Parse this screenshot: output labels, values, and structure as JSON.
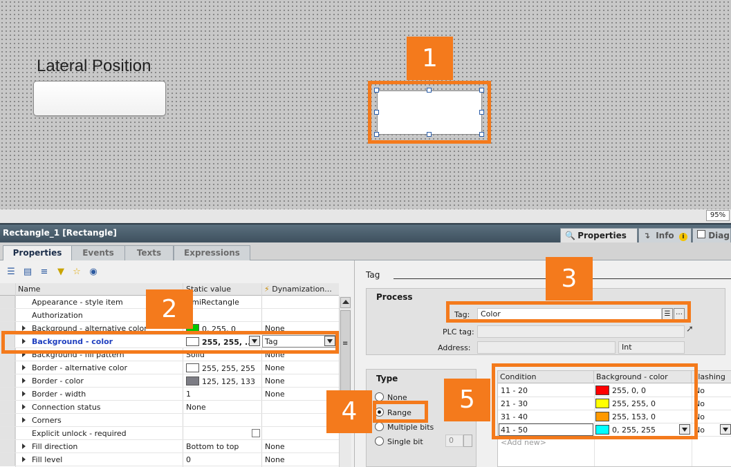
{
  "canvas": {
    "label_text": "Lateral Position",
    "zoom": "95%"
  },
  "panel": {
    "title": "Rectangle_1 [Rectangle]",
    "right_tabs": [
      {
        "label": "Properties",
        "icon": "properties-icon"
      },
      {
        "label": "Info",
        "icon": "info-icon"
      },
      {
        "label": "Diag",
        "icon": "diagnostics-icon"
      }
    ],
    "sub_tabs": [
      "Properties",
      "Events",
      "Texts",
      "Expressions"
    ]
  },
  "toolbar_icons": [
    "list-view-icon",
    "group-view-icon",
    "sort-icon",
    "filter-icon",
    "favorites-icon",
    "visibility-icon"
  ],
  "grid": {
    "headers": {
      "name": "Name",
      "static": "Static value",
      "dyn": "Dynamization..."
    },
    "rows": [
      {
        "name": "Appearance - style item",
        "static": "HmiRectangle",
        "dyn": "",
        "arrow": false
      },
      {
        "name": "Authorization",
        "static": "",
        "dyn": "",
        "arrow": false
      },
      {
        "name": "Background - alternative color",
        "static": "0, 255, 0",
        "dyn": "None",
        "arrow": true,
        "swatch": "#00c800"
      },
      {
        "name": "Background - color",
        "static": "255, 255, ...",
        "dyn": "Tag",
        "arrow": true,
        "swatch": "#ffffff",
        "selected": true
      },
      {
        "name": "Background - fill pattern",
        "static": "Solid",
        "dyn": "None",
        "arrow": true
      },
      {
        "name": "Border - alternative color",
        "static": "255, 255, 255",
        "dyn": "None",
        "arrow": true,
        "swatch": "#ffffff"
      },
      {
        "name": "Border - color",
        "static": "125, 125, 133",
        "dyn": "None",
        "arrow": true,
        "swatch": "#7d7d85"
      },
      {
        "name": "Border - width",
        "static": "1",
        "dyn": "None",
        "arrow": true
      },
      {
        "name": "Connection status",
        "static": "None",
        "dyn": "",
        "arrow": true
      },
      {
        "name": "Corners",
        "static": "",
        "dyn": "",
        "arrow": true
      },
      {
        "name": "Explicit unlock - required",
        "static": "",
        "dyn": "",
        "arrow": false,
        "checkbox": true
      },
      {
        "name": "Fill direction",
        "static": "Bottom to top",
        "dyn": "None",
        "arrow": true
      },
      {
        "name": "Fill level",
        "static": "0",
        "dyn": "None",
        "arrow": true
      }
    ]
  },
  "right": {
    "section_title": "Tag",
    "process": {
      "title": "Process",
      "tag_label": "Tag:",
      "tag_value": "Color",
      "plc_label": "PLC tag:",
      "address_label": "Address:",
      "address_type": "Int"
    },
    "type": {
      "title": "Type",
      "options": [
        "None",
        "Range",
        "Multiple bits",
        "Single bit"
      ],
      "selected": "Range",
      "bit_value": "0"
    },
    "table": {
      "headers": [
        "Condition",
        "Background - color",
        "Flashing"
      ],
      "rows": [
        {
          "condition": "11 - 20",
          "color": "255, 0, 0",
          "hex": "#ff0000",
          "flashing": "No"
        },
        {
          "condition": "21 - 30",
          "color": "255, 255, 0",
          "hex": "#ffff00",
          "flashing": "No"
        },
        {
          "condition": "31 - 40",
          "color": "255, 153, 0",
          "hex": "#ff9900",
          "flashing": "No"
        },
        {
          "condition": "41 - 50",
          "color": "0, 255, 255",
          "hex": "#00ffff",
          "flashing": "No"
        }
      ],
      "add_new": "<Add new>"
    }
  },
  "callouts": [
    "1",
    "2",
    "3",
    "4",
    "5"
  ],
  "accent_color": "#f47a1c"
}
